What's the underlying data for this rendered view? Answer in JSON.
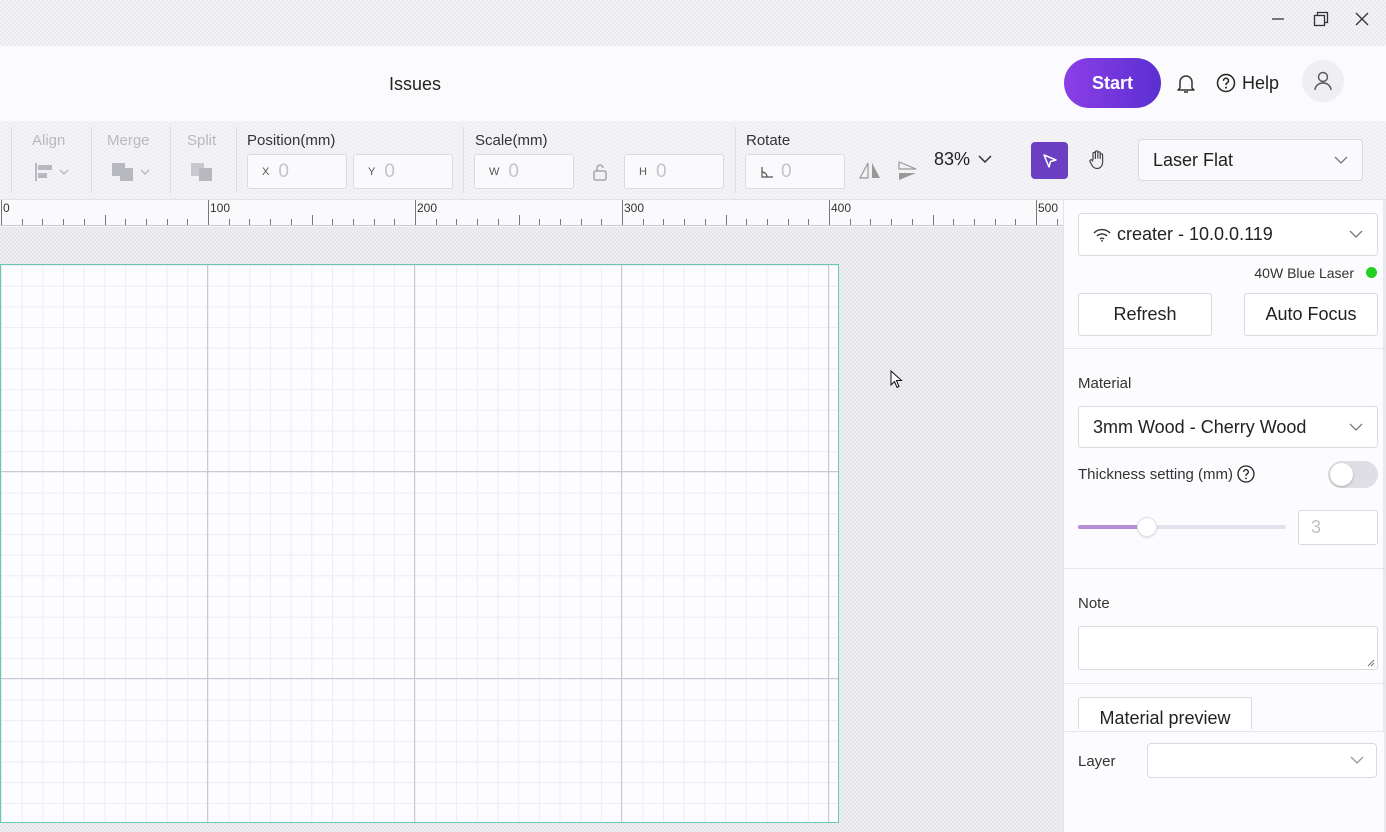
{
  "header": {
    "title": "Issues",
    "start_label": "Start",
    "help_label": "Help"
  },
  "toolbar": {
    "align_label": "Align",
    "merge_label": "Merge",
    "split_label": "Split",
    "position_label": "Position(mm)",
    "position_x_axis": "X",
    "position_x_value": "0",
    "position_y_axis": "Y",
    "position_y_value": "0",
    "scale_label": "Scale(mm)",
    "scale_w_axis": "W",
    "scale_w_value": "0",
    "scale_h_axis": "H",
    "scale_h_value": "0",
    "rotate_label": "Rotate",
    "rotate_value": "0",
    "zoom_value": "83%",
    "machine_mode": "Laser Flat"
  },
  "ruler": {
    "labels": [
      "0",
      "100",
      "200",
      "300",
      "400",
      "500"
    ]
  },
  "panel": {
    "device_name": "creater - 10.0.0.119",
    "laser_type": "40W Blue Laser",
    "status_color": "#22d022",
    "refresh_label": "Refresh",
    "autofocus_label": "Auto Focus",
    "material_label": "Material",
    "material_value": "3mm Wood - Cherry Wood",
    "thickness_label": "Thickness setting (mm)",
    "thickness_enabled": false,
    "thickness_value": "3",
    "thickness_slider_fraction": 0.33,
    "note_label": "Note",
    "note_value": "",
    "material_preview_label": "Material preview",
    "layer_label": "Layer",
    "layer_value": ""
  },
  "colors": {
    "accent": "#6a3fc2",
    "start_gradient_from": "#8b3fe6",
    "start_gradient_to": "#5b2fd1",
    "workarea_border": "#66c8b4"
  }
}
